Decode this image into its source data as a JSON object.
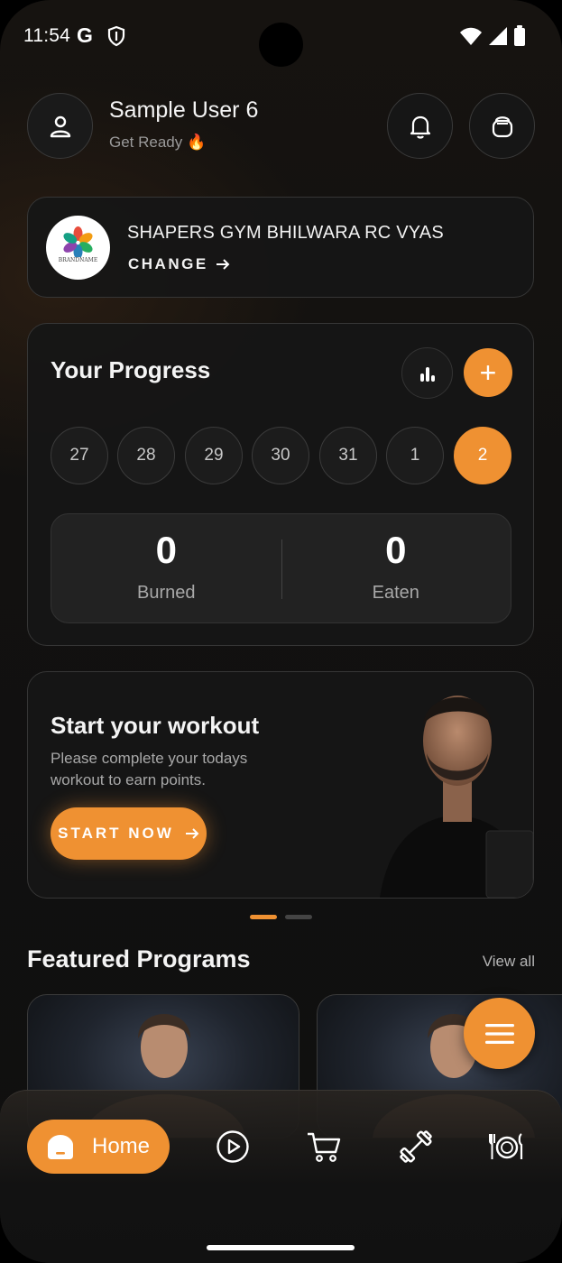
{
  "status_bar": {
    "time": "11:54",
    "google_icon": "G",
    "icons": [
      "google-icon",
      "shield-icon",
      "wifi-icon",
      "signal-icon",
      "battery-icon"
    ]
  },
  "header": {
    "user_name": "Sample User 6",
    "subtitle": "Get Ready 🔥",
    "icons": [
      "user-icon",
      "bell-icon",
      "bag-icon"
    ]
  },
  "gym": {
    "logo_text": "BRANDNAME",
    "name": "SHAPERS GYM BHILWARA RC VYAS",
    "change_label": "CHANGE"
  },
  "progress": {
    "title": "Your Progress",
    "add_symbol": "+",
    "days": [
      "27",
      "28",
      "29",
      "30",
      "31",
      "1",
      "2"
    ],
    "selected_day": "2",
    "burned_value": "0",
    "burned_label": "Burned",
    "eaten_value": "0",
    "eaten_label": "Eaten"
  },
  "workout": {
    "title": "Start your workout",
    "description": "Please complete your todays workout to earn points.",
    "button_label": "START NOW",
    "carousel_pages": 2,
    "carousel_active": 1
  },
  "featured": {
    "title": "Featured Programs",
    "view_all": "View all"
  },
  "nav": {
    "home_label": "Home",
    "items": [
      "home",
      "play",
      "cart",
      "dumbbell",
      "plate"
    ]
  },
  "colors": {
    "accent": "#ef9132",
    "background": "#121110",
    "card": "#161616",
    "border": "#363636",
    "muted_text": "#a8a8a8"
  }
}
